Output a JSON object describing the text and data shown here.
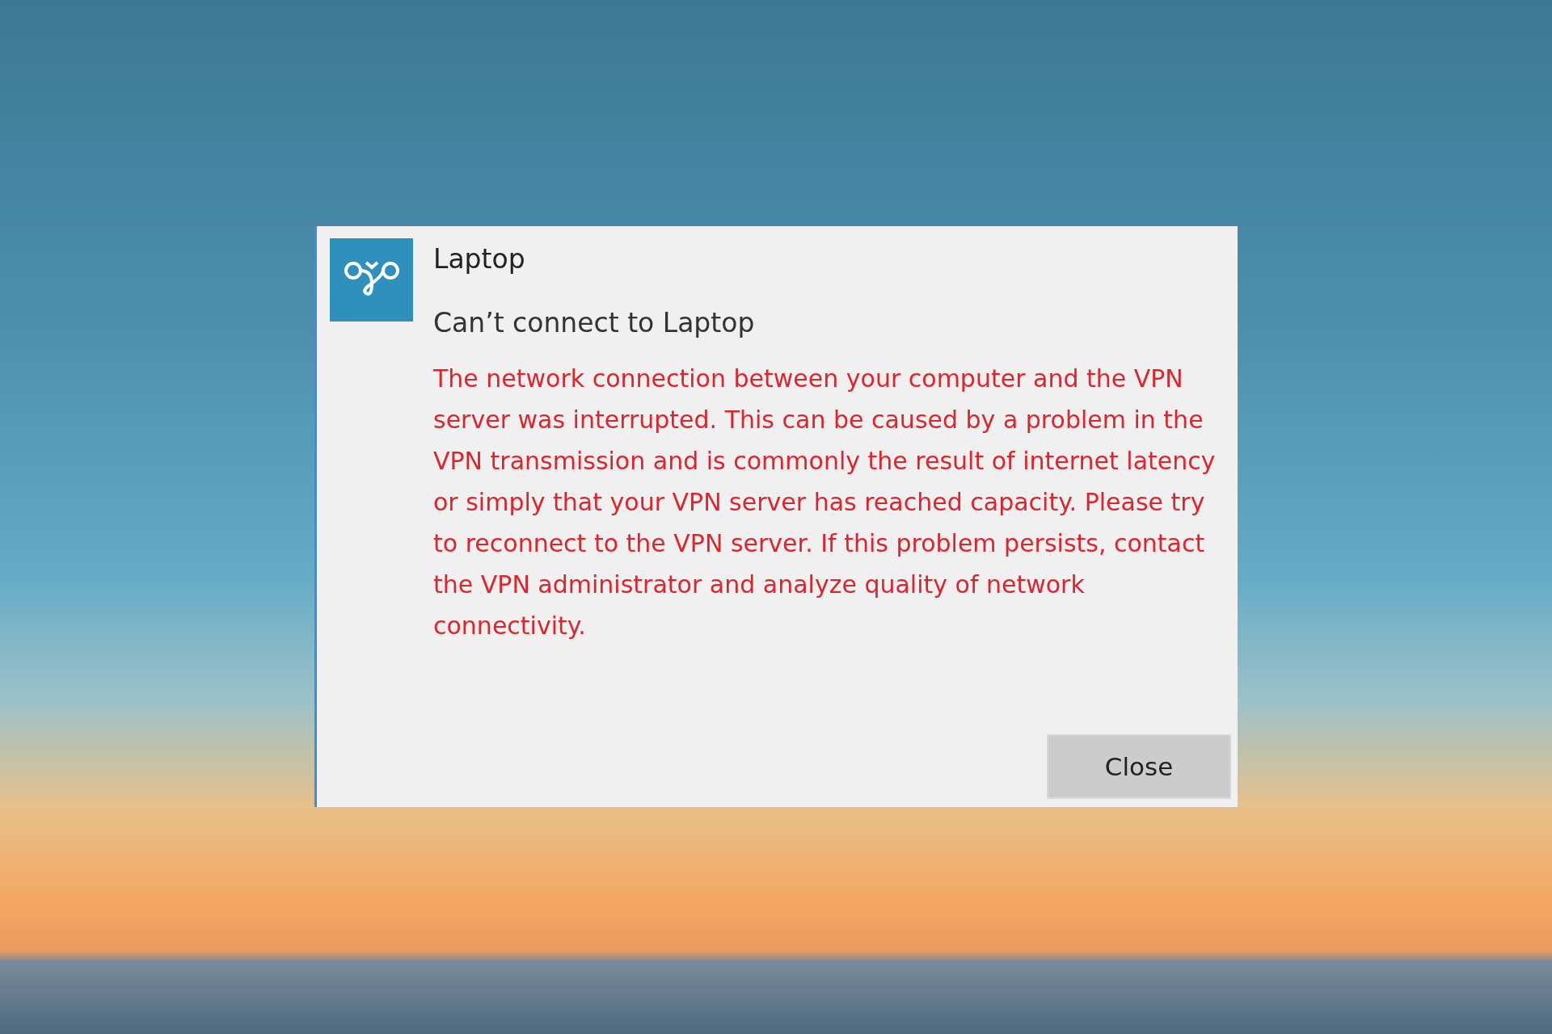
{
  "dialog": {
    "app_name": "Laptop",
    "heading": "Can’t connect to Laptop",
    "message": "The network connection between your computer and the VPN server was interrupted.  This can be caused by a problem in the VPN transmission and is commonly the result of internet latency or simply that your VPN server has reached capacity.  Please try to reconnect to the VPN server.  If this problem persists, contact the VPN administrator and analyze quality of network connectivity.",
    "buttons": [
      "Close"
    ]
  }
}
